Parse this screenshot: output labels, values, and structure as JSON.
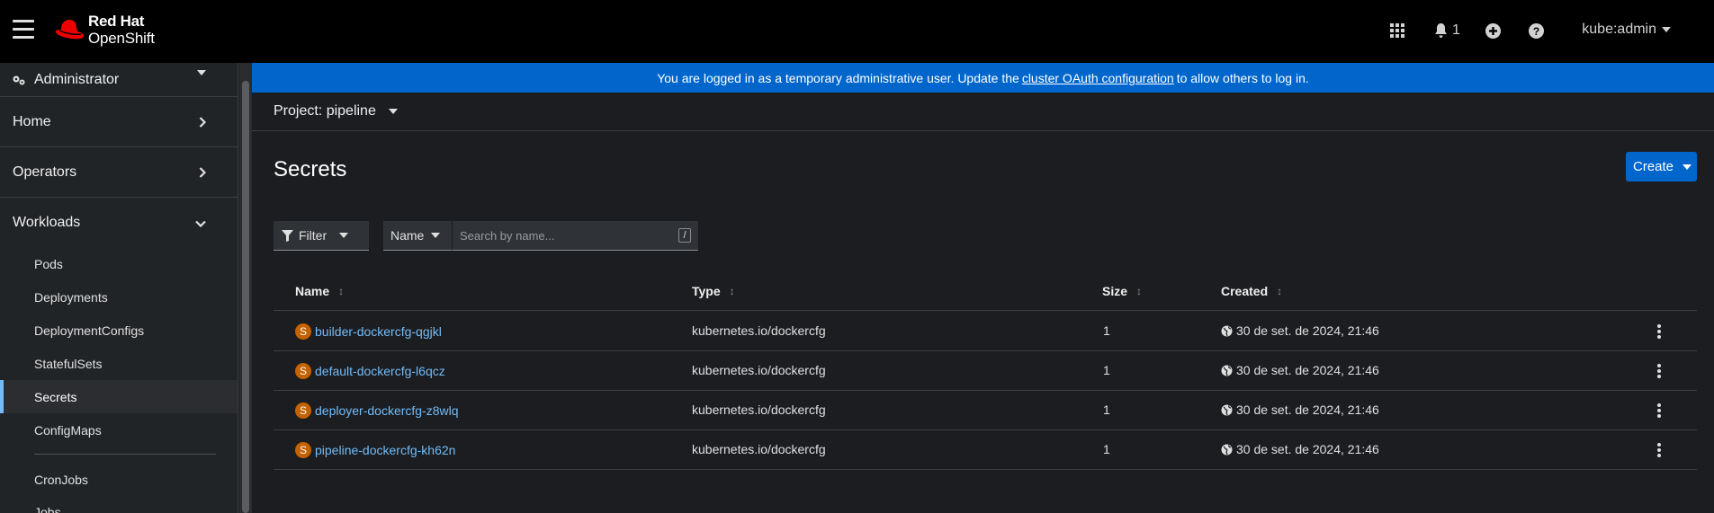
{
  "masthead": {
    "brand_line1": "Red Hat",
    "brand_line2": "OpenShift",
    "notification_count": "1",
    "user": "kube:admin"
  },
  "sidebar": {
    "perspective": "Administrator",
    "sections": [
      {
        "label": "Home"
      },
      {
        "label": "Operators"
      },
      {
        "label": "Workloads"
      }
    ],
    "workload_items": [
      {
        "label": "Pods"
      },
      {
        "label": "Deployments"
      },
      {
        "label": "DeploymentConfigs"
      },
      {
        "label": "StatefulSets"
      },
      {
        "label": "Secrets"
      },
      {
        "label": "ConfigMaps"
      },
      {
        "label": "CronJobs"
      },
      {
        "label": "Jobs"
      }
    ]
  },
  "banner": {
    "prefix": "You are logged in as a temporary administrative user. Update the",
    "link": "cluster OAuth configuration",
    "suffix": "to allow others to log in."
  },
  "project": {
    "label": "Project: pipeline"
  },
  "page": {
    "title": "Secrets",
    "create_label": "Create"
  },
  "toolbar": {
    "filter_label": "Filter",
    "name_label": "Name",
    "search_placeholder": "Search by name...",
    "shortcut": "/"
  },
  "table": {
    "headers": {
      "name": "Name",
      "type": "Type",
      "size": "Size",
      "created": "Created"
    },
    "rows": [
      {
        "badge": "S",
        "name": "builder-dockercfg-qgjkl",
        "type": "kubernetes.io/dockercfg",
        "size": "1",
        "created": "30 de set. de 2024, 21:46"
      },
      {
        "badge": "S",
        "name": "default-dockercfg-l6qcz",
        "type": "kubernetes.io/dockercfg",
        "size": "1",
        "created": "30 de set. de 2024, 21:46"
      },
      {
        "badge": "S",
        "name": "deployer-dockercfg-z8wlq",
        "type": "kubernetes.io/dockercfg",
        "size": "1",
        "created": "30 de set. de 2024, 21:46"
      },
      {
        "badge": "S",
        "name": "pipeline-dockercfg-kh62n",
        "type": "kubernetes.io/dockercfg",
        "size": "1",
        "created": "30 de set. de 2024, 21:46"
      }
    ]
  }
}
